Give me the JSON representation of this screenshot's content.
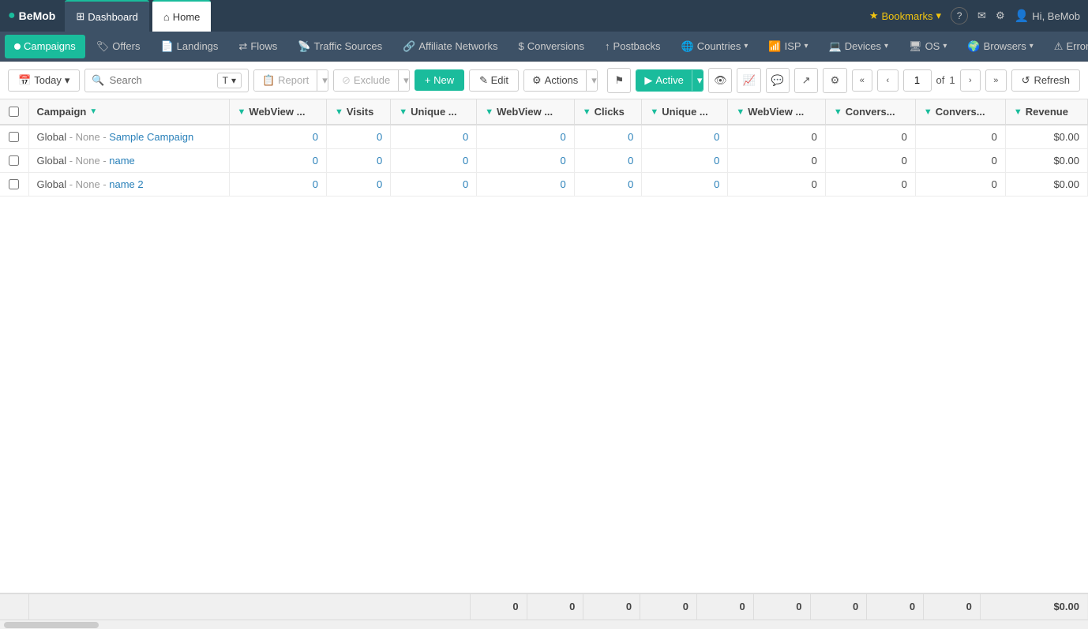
{
  "brand": {
    "icon": "●",
    "name": "BeMob"
  },
  "topNav": {
    "tabs": [
      {
        "id": "dashboard",
        "label": "Dashboard",
        "icon": "⊞",
        "active": false
      },
      {
        "id": "home",
        "label": "Home",
        "icon": "⌂",
        "active": true
      }
    ],
    "right": {
      "bookmarks_label": "Bookmarks",
      "help_icon": "?",
      "notification_icon": "✉",
      "settings_icon": "⚙",
      "user_label": "Hi, BeMob"
    }
  },
  "secondNav": {
    "items": [
      {
        "id": "campaigns",
        "label": "Campaigns",
        "icon": "dot",
        "active": true
      },
      {
        "id": "offers",
        "label": "Offers",
        "icon": "tag"
      },
      {
        "id": "landings",
        "label": "Landings",
        "icon": "page"
      },
      {
        "id": "flows",
        "label": "Flows",
        "icon": "flow"
      },
      {
        "id": "traffic_sources",
        "label": "Traffic Sources",
        "icon": "ts"
      },
      {
        "id": "affiliate_networks",
        "label": "Affiliate Networks",
        "icon": "an"
      },
      {
        "id": "conversions",
        "label": "Conversions",
        "icon": "conv"
      },
      {
        "id": "postbacks",
        "label": "Postbacks",
        "icon": "pb"
      },
      {
        "id": "countries",
        "label": "Countries",
        "icon": "globe",
        "dropdown": true
      },
      {
        "id": "isp",
        "label": "ISP",
        "icon": "wifi",
        "dropdown": true
      },
      {
        "id": "devices",
        "label": "Devices",
        "icon": "device",
        "dropdown": true
      },
      {
        "id": "os",
        "label": "OS",
        "icon": "os",
        "dropdown": true
      },
      {
        "id": "browsers",
        "label": "Browsers",
        "icon": "browser",
        "dropdown": true
      },
      {
        "id": "errors",
        "label": "Errors",
        "icon": "error"
      }
    ]
  },
  "toolbar": {
    "today_label": "Today",
    "search_placeholder": "Search",
    "search_type": "T",
    "report_label": "Report",
    "exclude_label": "Exclude",
    "new_label": "+ New",
    "edit_label": "✎ Edit",
    "actions_label": "Actions",
    "active_label": "Active",
    "refresh_label": "Refresh",
    "page_current": "1",
    "page_total": "1"
  },
  "table": {
    "columns": [
      {
        "id": "campaign",
        "label": "Campaign",
        "filter": false,
        "sortable": true
      },
      {
        "id": "webview1",
        "label": "WebView ...",
        "filter": true
      },
      {
        "id": "visits",
        "label": "Visits",
        "filter": true
      },
      {
        "id": "unique1",
        "label": "Unique ...",
        "filter": true
      },
      {
        "id": "webview2",
        "label": "WebView ...",
        "filter": true
      },
      {
        "id": "clicks",
        "label": "Clicks",
        "filter": true
      },
      {
        "id": "unique2",
        "label": "Unique ...",
        "filter": true
      },
      {
        "id": "webview3",
        "label": "WebView ...",
        "filter": true
      },
      {
        "id": "convers1",
        "label": "Convers...",
        "filter": true
      },
      {
        "id": "convers2",
        "label": "Convers...",
        "filter": true
      },
      {
        "id": "revenue",
        "label": "Revenue",
        "filter": true
      }
    ],
    "rows": [
      {
        "id": 1,
        "campaign_prefix": "Global - None - ",
        "campaign_name": "Sample Campaign",
        "webview1": "0",
        "visits": "0",
        "unique1": "0",
        "webview2": "0",
        "clicks": "0",
        "unique2": "0",
        "webview3": "0",
        "convers1": "0",
        "convers2": "0",
        "revenue": "$0.00"
      },
      {
        "id": 2,
        "campaign_prefix": "Global - None - ",
        "campaign_name": "name",
        "webview1": "0",
        "visits": "0",
        "unique1": "0",
        "webview2": "0",
        "clicks": "0",
        "unique2": "0",
        "webview3": "0",
        "convers1": "0",
        "convers2": "0",
        "revenue": "$0.00"
      },
      {
        "id": 3,
        "campaign_prefix": "Global - None - ",
        "campaign_name": "name 2",
        "webview1": "0",
        "visits": "0",
        "unique1": "0",
        "webview2": "0",
        "clicks": "0",
        "unique2": "0",
        "webview3": "0",
        "convers1": "0",
        "convers2": "0",
        "revenue": "$0.00"
      }
    ],
    "footer": {
      "webview1": "0",
      "visits": "0",
      "unique1": "0",
      "webview2": "0",
      "clicks": "0",
      "unique2": "0",
      "webview3": "0",
      "convers1": "0",
      "convers2": "0",
      "revenue": "$0.00"
    }
  }
}
